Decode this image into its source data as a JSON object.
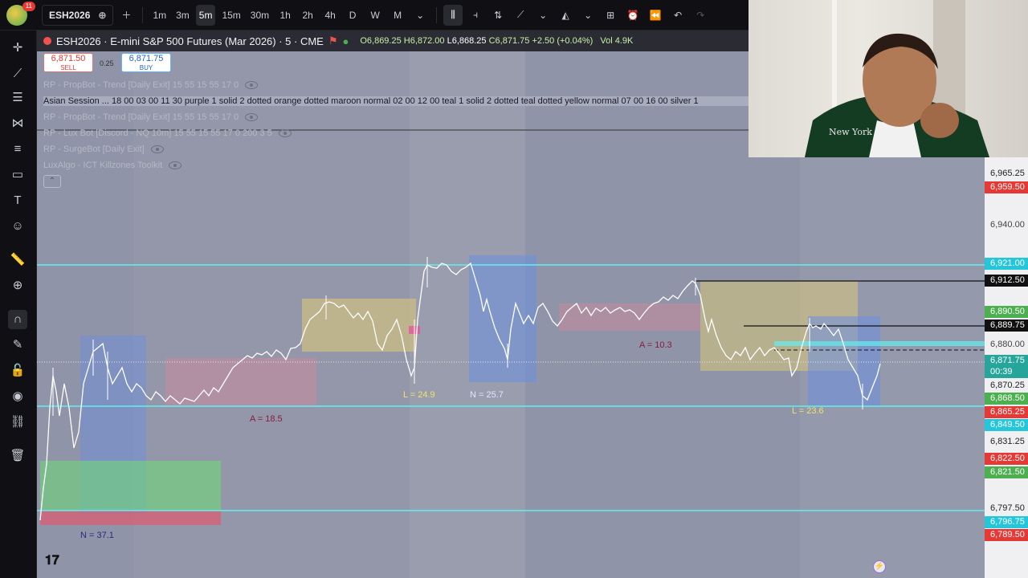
{
  "toolbar": {
    "notification_count": "11",
    "symbol": "ESH2026",
    "timeframes": [
      "1m",
      "3m",
      "5m",
      "15m",
      "30m",
      "1h",
      "2h",
      "4h",
      "D",
      "W",
      "M"
    ],
    "active_timeframe": "5m"
  },
  "legend": {
    "title": "ESH2026 · E-mini S&P 500 Futures (Mar 2026) · 5 · CME",
    "open": "O6,869.25",
    "high": "H6,872.00",
    "low": "L6,868.25",
    "close": "C6,871.75",
    "change": "+2.50 (+0.04%)",
    "volume": "Vol 4.9K"
  },
  "trade": {
    "sell_price": "6,871.50",
    "sell_label": "SELL",
    "buy_price": "6,871.75",
    "buy_label": "BUY",
    "spread": "0.25"
  },
  "indicators": [
    "RP - PropBot - Trend [Daily Exit] 15 55 15 55 17 0",
    "Asian Session ... 18 00 03 00 11 30 purple 1 solid 2 dotted orange dotted maroon normal 02 00 12 00 teal 1 solid 2 dotted teal dotted yellow normal 07 00 16 00 silver 1",
    "RP - PropBot - Trend [Daily Exit] 15 55 15 55 17 0",
    "RP - Lux Bot [Discord - NQ 10m] 15 55 15 55 17 0 200 3 5",
    "RP - SurgeBot [Daily Exit]",
    "LuxAlgo - ICT Killzones Toolkit"
  ],
  "annotations": {
    "a1": "A = 18.5",
    "l1": "L = 24.9",
    "n1": "N = 25.7",
    "a2": "A = 10.3",
    "l2": "L = 23.6",
    "n2": "N = 37.1"
  },
  "price_axis": [
    {
      "text": "6,965.25",
      "bg": "#f0f0f3",
      "fg": "#222"
    },
    {
      "text": "6,959.50",
      "bg": "#e53935",
      "fg": "#fff"
    },
    {
      "text": "6,940.00",
      "bg": "#f0f0f3",
      "fg": "#444"
    },
    {
      "text": "6,921.00",
      "bg": "#26c6da",
      "fg": "#fff"
    },
    {
      "text": "6,912.50",
      "bg": "#111111",
      "fg": "#fff"
    },
    {
      "text": "6,890.50",
      "bg": "#4caf50",
      "fg": "#fff"
    },
    {
      "text": "6,889.75",
      "bg": "#111111",
      "fg": "#fff"
    },
    {
      "text": "6,880.00",
      "bg": "#f0f0f3",
      "fg": "#444"
    },
    {
      "text": "6,871.75",
      "bg": "#26a69a",
      "fg": "#fff"
    },
    {
      "text": "00:39",
      "bg": "#26a69a",
      "fg": "#fff"
    },
    {
      "text": "6,870.25",
      "bg": "#f0f0f3",
      "fg": "#222"
    },
    {
      "text": "6,868.50",
      "bg": "#4caf50",
      "fg": "#fff"
    },
    {
      "text": "6,865.25",
      "bg": "#e53935",
      "fg": "#fff"
    },
    {
      "text": "6,849.50",
      "bg": "#26c6da",
      "fg": "#fff"
    },
    {
      "text": "6,831.25",
      "bg": "#f0f0f3",
      "fg": "#222"
    },
    {
      "text": "6,822.50",
      "bg": "#e53935",
      "fg": "#fff"
    },
    {
      "text": "6,821.50",
      "bg": "#4caf50",
      "fg": "#fff"
    },
    {
      "text": "6,797.50",
      "bg": "#f0f0f3",
      "fg": "#222"
    },
    {
      "text": "6,796.75",
      "bg": "#26c6da",
      "fg": "#fff"
    },
    {
      "text": "6,789.50",
      "bg": "#e53935",
      "fg": "#fff"
    }
  ],
  "colors": {
    "chart_bg": "#8f94a8",
    "candle": "#ffffff",
    "level_line": "#5ff0f0",
    "box_blue": "#6b8fe0",
    "box_yellow": "#d8c77a",
    "box_red": "#c98a9c",
    "box_green": "#6fd77a"
  }
}
